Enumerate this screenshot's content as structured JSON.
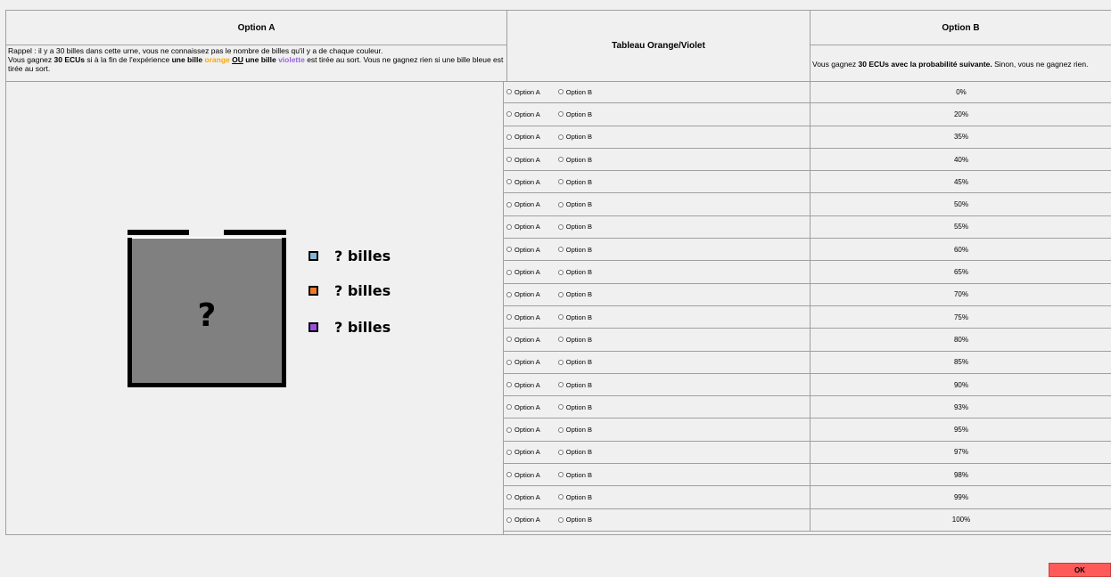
{
  "headers": {
    "option_a": "Option A",
    "table": "Tableau Orange/Violet",
    "option_b": "Option B"
  },
  "option_a_desc": {
    "line1": "Rappel : il y a 30 billes dans cette urne, vous ne connaissez pas le nombre de billes qu'il y a de chaque couleur.",
    "l2_a": "Vous gagnez ",
    "l2_b": "30 ECUs",
    "l2_c": " si à la fin de l'expérience ",
    "l2_d": "une bille",
    "l2_e": " orange ",
    "l2_f": "OU",
    "l2_g": " une bille",
    "l2_h": " violette",
    "l2_i": " est tirée au sort. Vous ne gagnez rien si une bille bleue est tirée au sort."
  },
  "option_b_desc": {
    "a": "Vous gagnez ",
    "b": "30 ECUs avec la probabilité suivante.",
    "c": " Sinon, vous ne gagnez rien."
  },
  "urn": {
    "mark": "?",
    "legend": [
      {
        "label": "? billes",
        "color": "#87b5d6"
      },
      {
        "label": "? billes",
        "color": "#f07c2a"
      },
      {
        "label": "? billes",
        "color": "#9b4fe0"
      }
    ]
  },
  "radio_labels": {
    "a": "Option A",
    "b": "Option B"
  },
  "probabilities": [
    "0%",
    "20%",
    "35%",
    "40%",
    "45%",
    "50%",
    "55%",
    "60%",
    "65%",
    "70%",
    "75%",
    "80%",
    "85%",
    "90%",
    "93%",
    "95%",
    "97%",
    "98%",
    "99%",
    "100%"
  ],
  "ok_label": "OK"
}
